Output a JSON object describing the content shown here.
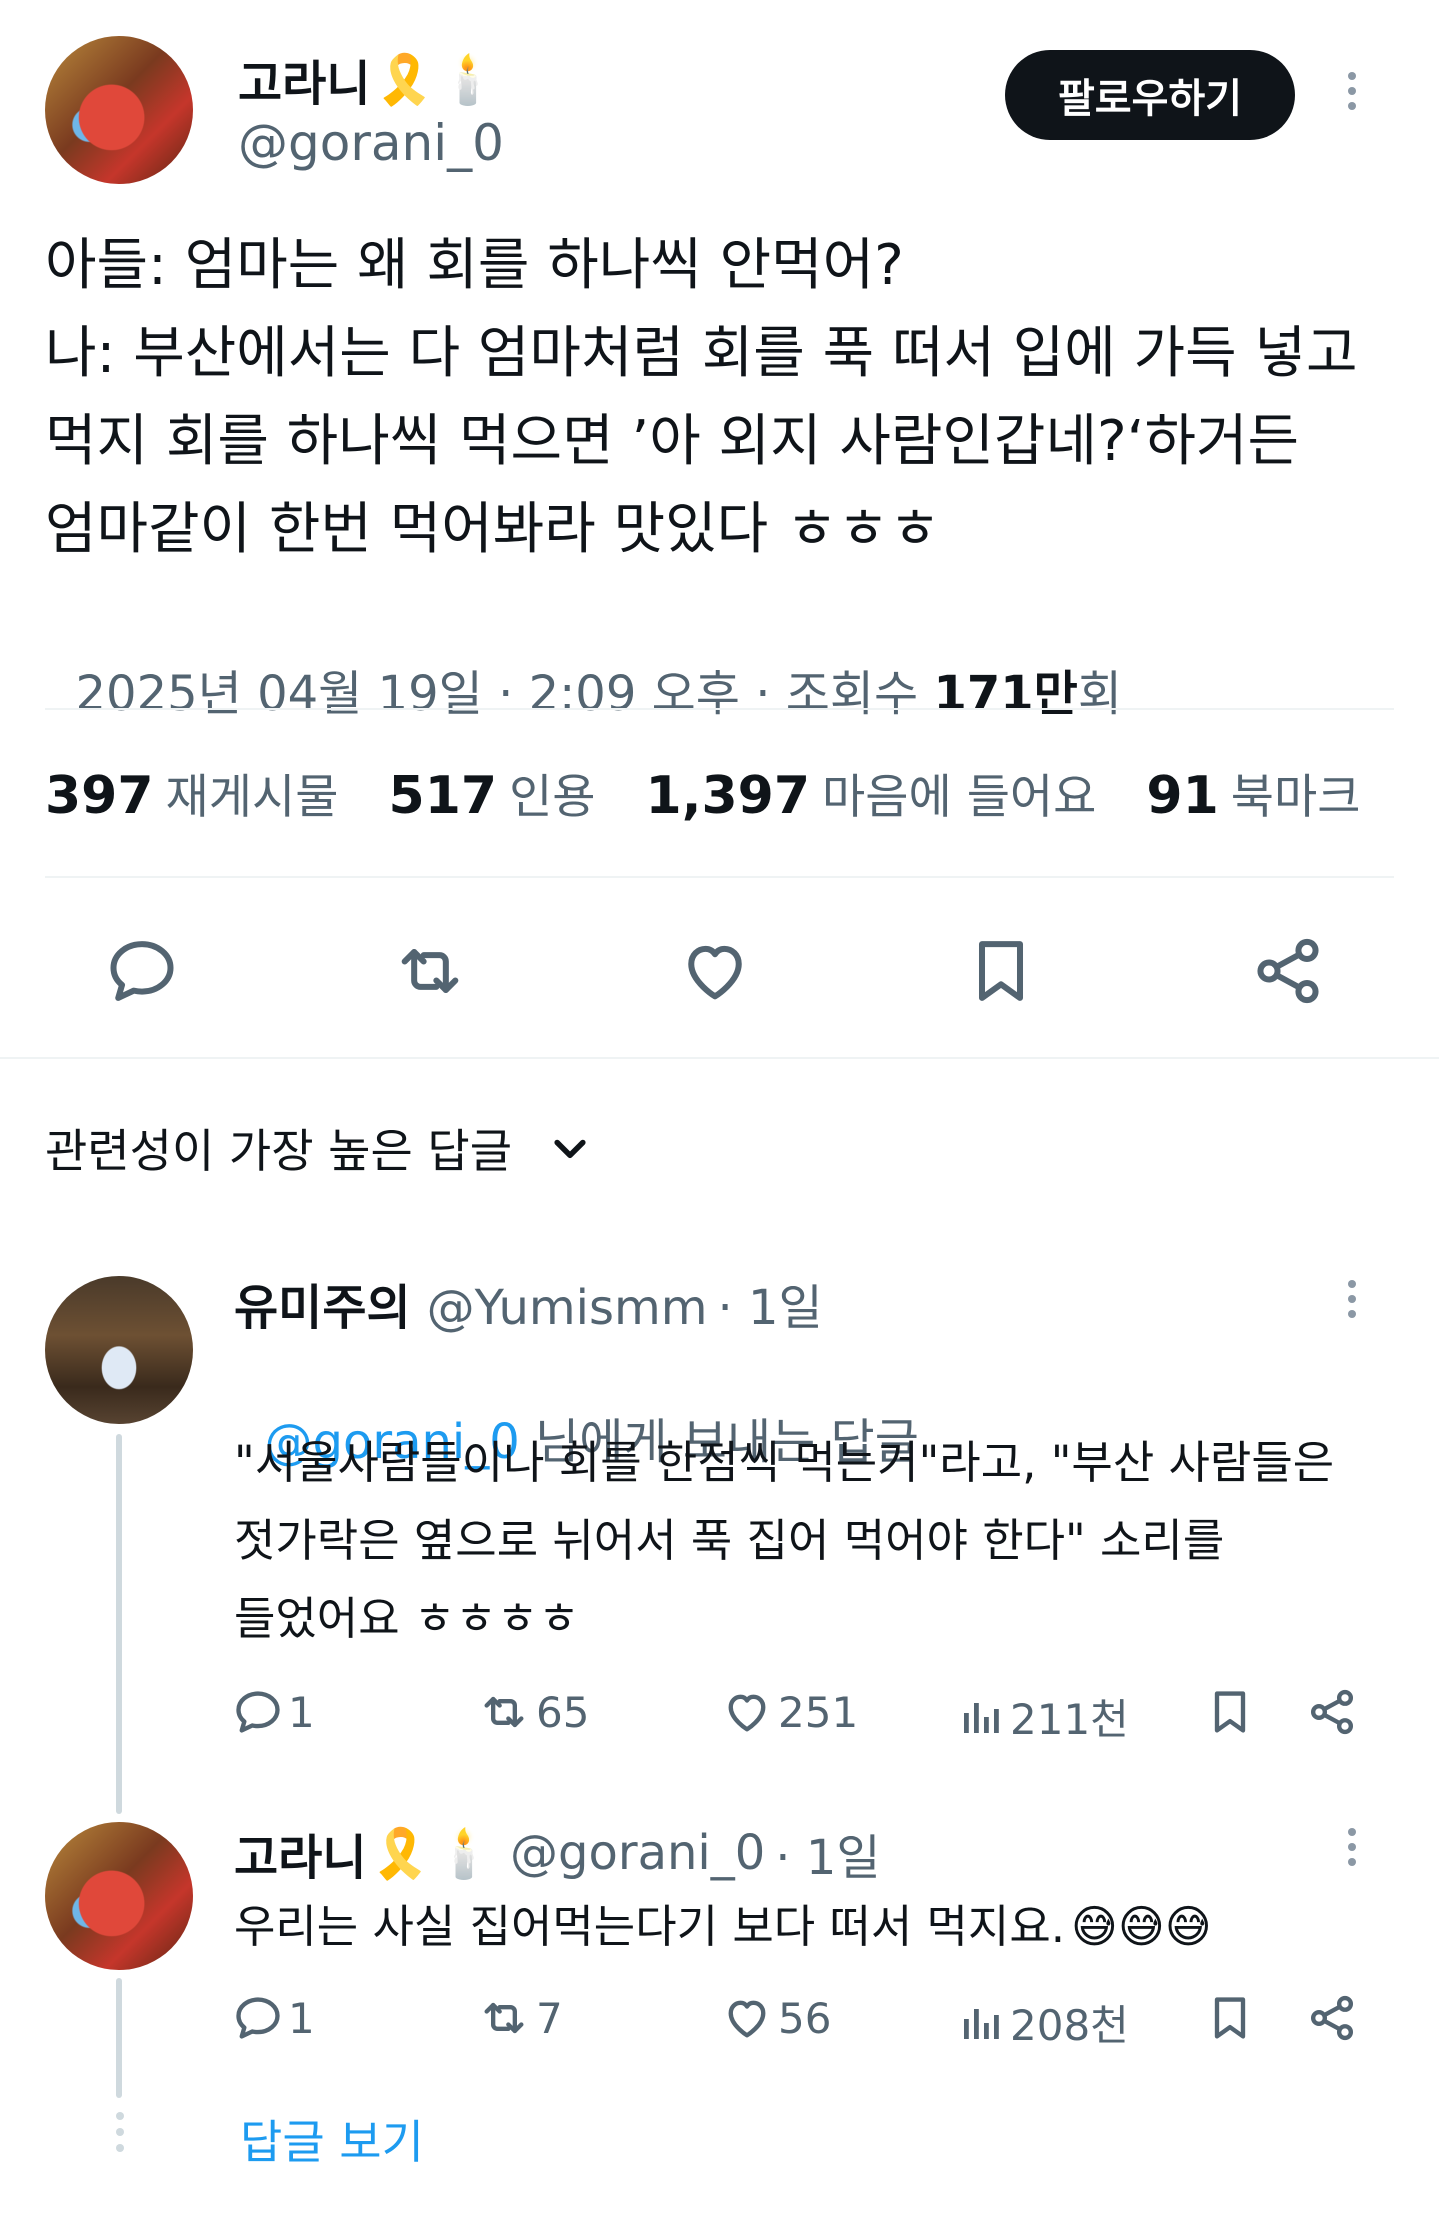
{
  "main_tweet": {
    "author_name": "고라니",
    "ribbon_emoji": "🎗️",
    "candle_emoji": "🕯️",
    "handle": "@gorani_0",
    "follow_label": "팔로우하기",
    "lines": [
      "아들: 엄마는 왜 회를 하나씩 안먹어?",
      "나: 부산에서는 다 엄마처럼 회를 푹 떠서 입에 가득 넣고",
      "먹지 회를 하나씩 먹으면 ’아 외지 사람인갑네?‘하거든",
      "엄마같이 한번 먹어봐라 맛있다 ㅎㅎㅎ"
    ],
    "meta_date": "2025년 04월 19일 · 2:09 오후 · 조회수 ",
    "meta_views_number": "171만",
    "meta_views_suffix": "회",
    "stats": [
      {
        "number": "397",
        "label": "재게시물"
      },
      {
        "number": "517",
        "label": "인용"
      },
      {
        "number": "1,397",
        "label": "마음에 들어요"
      },
      {
        "number": "91",
        "label": "북마크"
      }
    ],
    "actions": [
      "reply-icon",
      "retweet-icon",
      "like-icon",
      "bookmark-icon",
      "share-icon"
    ]
  },
  "sort": {
    "label": "관련성이 가장 높은 답글"
  },
  "replies": [
    {
      "name": "유미주의",
      "handle": "@Yumismm",
      "time": "· 1일",
      "replying_to_handle": "@gorani_0",
      "replying_to_suffix": " 님에게 보내는 답글",
      "lines": [
        "\"서울사람들이나 회를 한점씩 먹는거\"라고, \"부산 사람들은",
        "젓가락은 옆으로 뉘어서 푹 집어 먹어야 한다\" 소리를",
        "들었어요 ㅎㅎㅎㅎ"
      ],
      "counts": {
        "reply": "1",
        "retweet": "65",
        "like": "251",
        "views": "211천"
      }
    },
    {
      "name": "고라니",
      "ribbon_emoji": "🎗️",
      "candle_emoji": "🕯️",
      "handle": "@gorani_0",
      "time": "· 1일",
      "text": "우리는 사실 집어먹는다기 보다 떠서 먹지요.",
      "emojis": "😅😅😅",
      "counts": {
        "reply": "1",
        "retweet": "7",
        "like": "56",
        "views": "208천"
      }
    }
  ],
  "show_replies_label": "답글 보기",
  "colors": {
    "text": "#0f1419",
    "secondary": "#536471",
    "link": "#1d9bf0",
    "follow_bg": "#0f1419",
    "divider": "#eff3f4"
  }
}
